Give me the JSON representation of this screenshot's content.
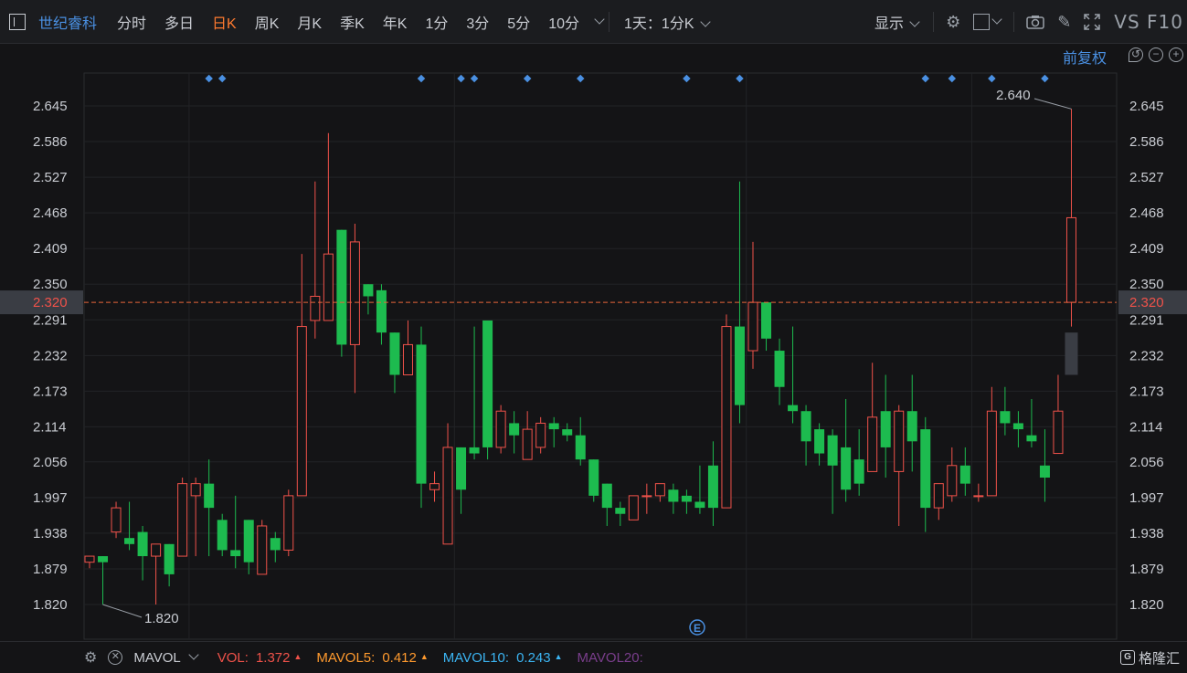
{
  "toolbar": {
    "stock_name": "世纪睿科",
    "periods": [
      "分时",
      "多日",
      "日K",
      "周K",
      "月K",
      "季K",
      "年K",
      "1分",
      "3分",
      "5分",
      "10分"
    ],
    "active_period": "日K",
    "interval_select": "1天：1分K",
    "display_label": "显示",
    "vs_label": "VS",
    "f10_label": "F10"
  },
  "adjust_label": "前复权",
  "price_axis": {
    "ticks": [
      "2.645",
      "2.586",
      "2.527",
      "2.468",
      "2.409",
      "2.350",
      "2.291",
      "2.232",
      "2.173",
      "2.114",
      "2.056",
      "1.997",
      "1.938",
      "1.879",
      "1.820"
    ],
    "current_price": "2.320",
    "high_annotation": "2.640",
    "low_annotation": "1.820"
  },
  "event_marker": "E",
  "indicators": {
    "name": "MAVOL",
    "items": [
      {
        "label": "VOL:",
        "value": "1.372",
        "color": "#f0524a",
        "arrow": "▲"
      },
      {
        "label": "MAVOL5:",
        "value": "0.412",
        "color": "#ff9a2e",
        "arrow": "▲"
      },
      {
        "label": "MAVOL10:",
        "value": "0.243",
        "color": "#3bb4f2",
        "arrow": "▲"
      },
      {
        "label": "MAVOL20:",
        "value": "",
        "color": "#7a3e8c",
        "arrow": ""
      }
    ]
  },
  "brand": "格隆汇",
  "colors": {
    "up": "#f0524a",
    "down": "#1dbb4f",
    "accent": "#4a90e2",
    "active": "#ff7a2f",
    "price_line": "#e8663b"
  },
  "chart_data": {
    "type": "candlestick",
    "ylim": [
      1.79,
      2.67
    ],
    "current_price": 2.32,
    "high_mark": 2.64,
    "low_mark": 1.82,
    "candles": [
      {
        "o": 1.89,
        "c": 1.9,
        "h": 1.9,
        "l": 1.88
      },
      {
        "o": 1.9,
        "c": 1.89,
        "h": 1.9,
        "l": 1.82
      },
      {
        "o": 1.94,
        "c": 1.98,
        "h": 1.99,
        "l": 1.93
      },
      {
        "o": 1.93,
        "c": 1.92,
        "h": 1.99,
        "l": 1.91
      },
      {
        "o": 1.94,
        "c": 1.9,
        "h": 1.95,
        "l": 1.86
      },
      {
        "o": 1.9,
        "c": 1.92,
        "h": 1.92,
        "l": 1.82
      },
      {
        "o": 1.92,
        "c": 1.87,
        "h": 1.92,
        "l": 1.85
      },
      {
        "o": 1.9,
        "c": 2.02,
        "h": 2.03,
        "l": 1.9
      },
      {
        "o": 2.0,
        "c": 2.02,
        "h": 2.03,
        "l": 1.9
      },
      {
        "o": 2.02,
        "c": 1.98,
        "h": 2.06,
        "l": 1.9
      },
      {
        "o": 1.96,
        "c": 1.91,
        "h": 1.97,
        "l": 1.9
      },
      {
        "o": 1.91,
        "c": 1.9,
        "h": 2.0,
        "l": 1.88
      },
      {
        "o": 1.96,
        "c": 1.89,
        "h": 1.96,
        "l": 1.87
      },
      {
        "o": 1.87,
        "c": 1.95,
        "h": 1.96,
        "l": 1.87
      },
      {
        "o": 1.93,
        "c": 1.91,
        "h": 1.94,
        "l": 1.89
      },
      {
        "o": 1.91,
        "c": 2.0,
        "h": 2.01,
        "l": 1.9
      },
      {
        "o": 2.0,
        "c": 2.28,
        "h": 2.4,
        "l": 2.0
      },
      {
        "o": 2.29,
        "c": 2.33,
        "h": 2.52,
        "l": 2.26
      },
      {
        "o": 2.29,
        "c": 2.4,
        "h": 2.6,
        "l": 2.29
      },
      {
        "o": 2.44,
        "c": 2.25,
        "h": 2.44,
        "l": 2.23
      },
      {
        "o": 2.25,
        "c": 2.42,
        "h": 2.45,
        "l": 2.17
      },
      {
        "o": 2.35,
        "c": 2.33,
        "h": 2.35,
        "l": 2.3
      },
      {
        "o": 2.34,
        "c": 2.27,
        "h": 2.35,
        "l": 2.25
      },
      {
        "o": 2.27,
        "c": 2.2,
        "h": 2.27,
        "l": 2.17
      },
      {
        "o": 2.2,
        "c": 2.25,
        "h": 2.29,
        "l": 2.2
      },
      {
        "o": 2.25,
        "c": 2.02,
        "h": 2.28,
        "l": 1.98
      },
      {
        "o": 2.01,
        "c": 2.02,
        "h": 2.04,
        "l": 1.99
      },
      {
        "o": 1.92,
        "c": 2.08,
        "h": 2.12,
        "l": 1.92
      },
      {
        "o": 2.08,
        "c": 2.01,
        "h": 2.08,
        "l": 1.97
      },
      {
        "o": 2.08,
        "c": 2.07,
        "h": 2.28,
        "l": 2.06
      },
      {
        "o": 2.29,
        "c": 2.08,
        "h": 2.29,
        "l": 2.06
      },
      {
        "o": 2.08,
        "c": 2.14,
        "h": 2.15,
        "l": 2.07
      },
      {
        "o": 2.12,
        "c": 2.1,
        "h": 2.14,
        "l": 2.07
      },
      {
        "o": 2.06,
        "c": 2.11,
        "h": 2.14,
        "l": 2.06
      },
      {
        "o": 2.08,
        "c": 2.12,
        "h": 2.13,
        "l": 2.07
      },
      {
        "o": 2.12,
        "c": 2.11,
        "h": 2.13,
        "l": 2.08
      },
      {
        "o": 2.11,
        "c": 2.1,
        "h": 2.12,
        "l": 2.09
      },
      {
        "o": 2.1,
        "c": 2.06,
        "h": 2.13,
        "l": 2.05
      },
      {
        "o": 2.06,
        "c": 2.0,
        "h": 2.06,
        "l": 1.99
      },
      {
        "o": 2.02,
        "c": 1.98,
        "h": 2.02,
        "l": 1.95
      },
      {
        "o": 1.98,
        "c": 1.97,
        "h": 1.99,
        "l": 1.95
      },
      {
        "o": 1.96,
        "c": 2.0,
        "h": 2.0,
        "l": 1.96
      },
      {
        "o": 2.0,
        "c": 2.0,
        "h": 2.02,
        "l": 1.97
      },
      {
        "o": 2.0,
        "c": 2.02,
        "h": 2.02,
        "l": 1.99
      },
      {
        "o": 2.01,
        "c": 1.99,
        "h": 2.02,
        "l": 1.97
      },
      {
        "o": 2.0,
        "c": 1.99,
        "h": 2.01,
        "l": 1.97
      },
      {
        "o": 1.99,
        "c": 1.98,
        "h": 2.05,
        "l": 1.97
      },
      {
        "o": 2.05,
        "c": 1.98,
        "h": 2.09,
        "l": 1.95
      },
      {
        "o": 1.98,
        "c": 2.28,
        "h": 2.3,
        "l": 1.98
      },
      {
        "o": 2.28,
        "c": 2.15,
        "h": 2.52,
        "l": 2.12
      },
      {
        "o": 2.24,
        "c": 2.32,
        "h": 2.42,
        "l": 2.21
      },
      {
        "o": 2.32,
        "c": 2.26,
        "h": 2.32,
        "l": 2.24
      },
      {
        "o": 2.24,
        "c": 2.18,
        "h": 2.26,
        "l": 2.15
      },
      {
        "o": 2.15,
        "c": 2.14,
        "h": 2.28,
        "l": 2.12
      },
      {
        "o": 2.14,
        "c": 2.09,
        "h": 2.15,
        "l": 2.05
      },
      {
        "o": 2.11,
        "c": 2.07,
        "h": 2.12,
        "l": 2.05
      },
      {
        "o": 2.1,
        "c": 2.05,
        "h": 2.11,
        "l": 1.97
      },
      {
        "o": 2.08,
        "c": 2.01,
        "h": 2.16,
        "l": 1.99
      },
      {
        "o": 2.06,
        "c": 2.02,
        "h": 2.11,
        "l": 2.0
      },
      {
        "o": 2.04,
        "c": 2.13,
        "h": 2.22,
        "l": 2.04
      },
      {
        "o": 2.14,
        "c": 2.08,
        "h": 2.2,
        "l": 2.03
      },
      {
        "o": 2.04,
        "c": 2.14,
        "h": 2.15,
        "l": 1.95
      },
      {
        "o": 2.14,
        "c": 2.09,
        "h": 2.2,
        "l": 2.04
      },
      {
        "o": 2.11,
        "c": 1.98,
        "h": 2.13,
        "l": 1.94
      },
      {
        "o": 1.98,
        "c": 2.02,
        "h": 2.02,
        "l": 1.96
      },
      {
        "o": 2.0,
        "c": 2.05,
        "h": 2.08,
        "l": 1.99
      },
      {
        "o": 2.05,
        "c": 2.02,
        "h": 2.08,
        "l": 2.0
      },
      {
        "o": 2.0,
        "c": 2.0,
        "h": 2.02,
        "l": 1.99
      },
      {
        "o": 2.0,
        "c": 2.14,
        "h": 2.18,
        "l": 2.0
      },
      {
        "o": 2.14,
        "c": 2.12,
        "h": 2.18,
        "l": 2.1
      },
      {
        "o": 2.12,
        "c": 2.11,
        "h": 2.14,
        "l": 2.08
      },
      {
        "o": 2.1,
        "c": 2.09,
        "h": 2.16,
        "l": 2.08
      },
      {
        "o": 2.05,
        "c": 2.03,
        "h": 2.11,
        "l": 1.99
      },
      {
        "o": 2.07,
        "c": 2.14,
        "h": 2.2,
        "l": 2.07
      },
      {
        "o": 2.32,
        "c": 2.46,
        "h": 2.64,
        "l": 2.28
      }
    ],
    "ghost_bar": {
      "top": 2.27,
      "bottom": 2.2
    },
    "event_dots_at_candle": [
      9,
      10,
      25,
      28,
      29,
      33,
      37,
      45,
      49,
      63,
      65,
      68,
      72
    ],
    "vertical_grid_at_candle": [
      7.5,
      27.5,
      49.5,
      66.5
    ],
    "event_E_at_candle": 45.8
  }
}
